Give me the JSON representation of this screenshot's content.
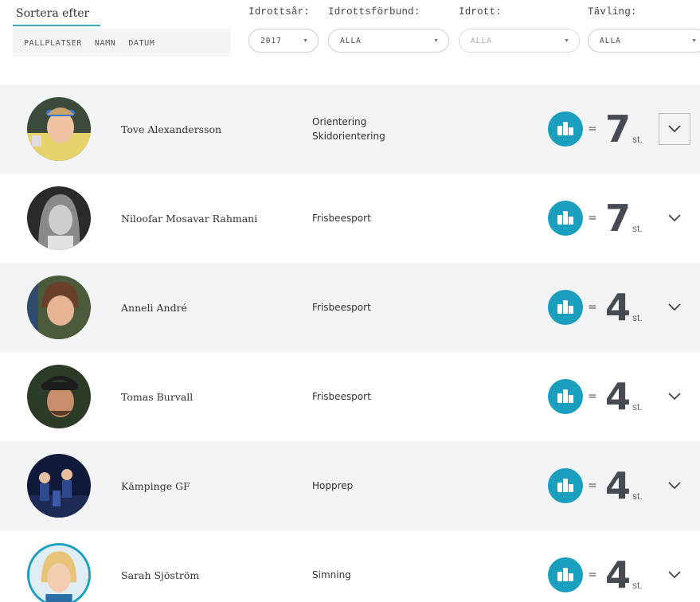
{
  "sort": {
    "title": "Sortera efter",
    "tabs": [
      "PALLPLATSER",
      "NAMN",
      "DATUM"
    ]
  },
  "filters": {
    "year": {
      "label": "Idrottsår:",
      "value": "2017"
    },
    "federation": {
      "label": "Idrottsförbund:",
      "value": "ALLA"
    },
    "sport": {
      "label": "Idrott:",
      "value": "ALLA"
    },
    "competition": {
      "label": "Tävling:",
      "value": "ALLA"
    }
  },
  "colors": {
    "accent": "#1a9fbf",
    "row_shade": "#f3f4f6"
  },
  "athletes": [
    {
      "name": "Tove Alexandersson",
      "sport_line1": "Orientering",
      "sport_line2": "Skidorientering",
      "count": "7",
      "unit": "st.",
      "equals": "=",
      "icon": "podium-icon",
      "expand_icon": "chevron-down-icon"
    },
    {
      "name": "Niloofar Mosavar Rahmani",
      "sport_line1": "Frisbeesport",
      "sport_line2": "",
      "count": "7",
      "unit": "st.",
      "equals": "=",
      "icon": "podium-icon",
      "expand_icon": "chevron-down-icon"
    },
    {
      "name": "Anneli André",
      "sport_line1": "Frisbeesport",
      "sport_line2": "",
      "count": "4",
      "unit": "st.",
      "equals": "=",
      "icon": "podium-icon",
      "expand_icon": "chevron-down-icon"
    },
    {
      "name": "Tomas Burvall",
      "sport_line1": "Frisbeesport",
      "sport_line2": "",
      "count": "4",
      "unit": "st.",
      "equals": "=",
      "icon": "podium-icon",
      "expand_icon": "chevron-down-icon"
    },
    {
      "name": "Kämpinge GF",
      "sport_line1": "Hopprep",
      "sport_line2": "",
      "count": "4",
      "unit": "st.",
      "equals": "=",
      "icon": "podium-icon",
      "expand_icon": "chevron-down-icon"
    },
    {
      "name": "Sarah Sjöström",
      "sport_line1": "Simning",
      "sport_line2": "",
      "count": "4",
      "unit": "st.",
      "equals": "=",
      "icon": "podium-icon",
      "expand_icon": "chevron-down-icon"
    }
  ]
}
